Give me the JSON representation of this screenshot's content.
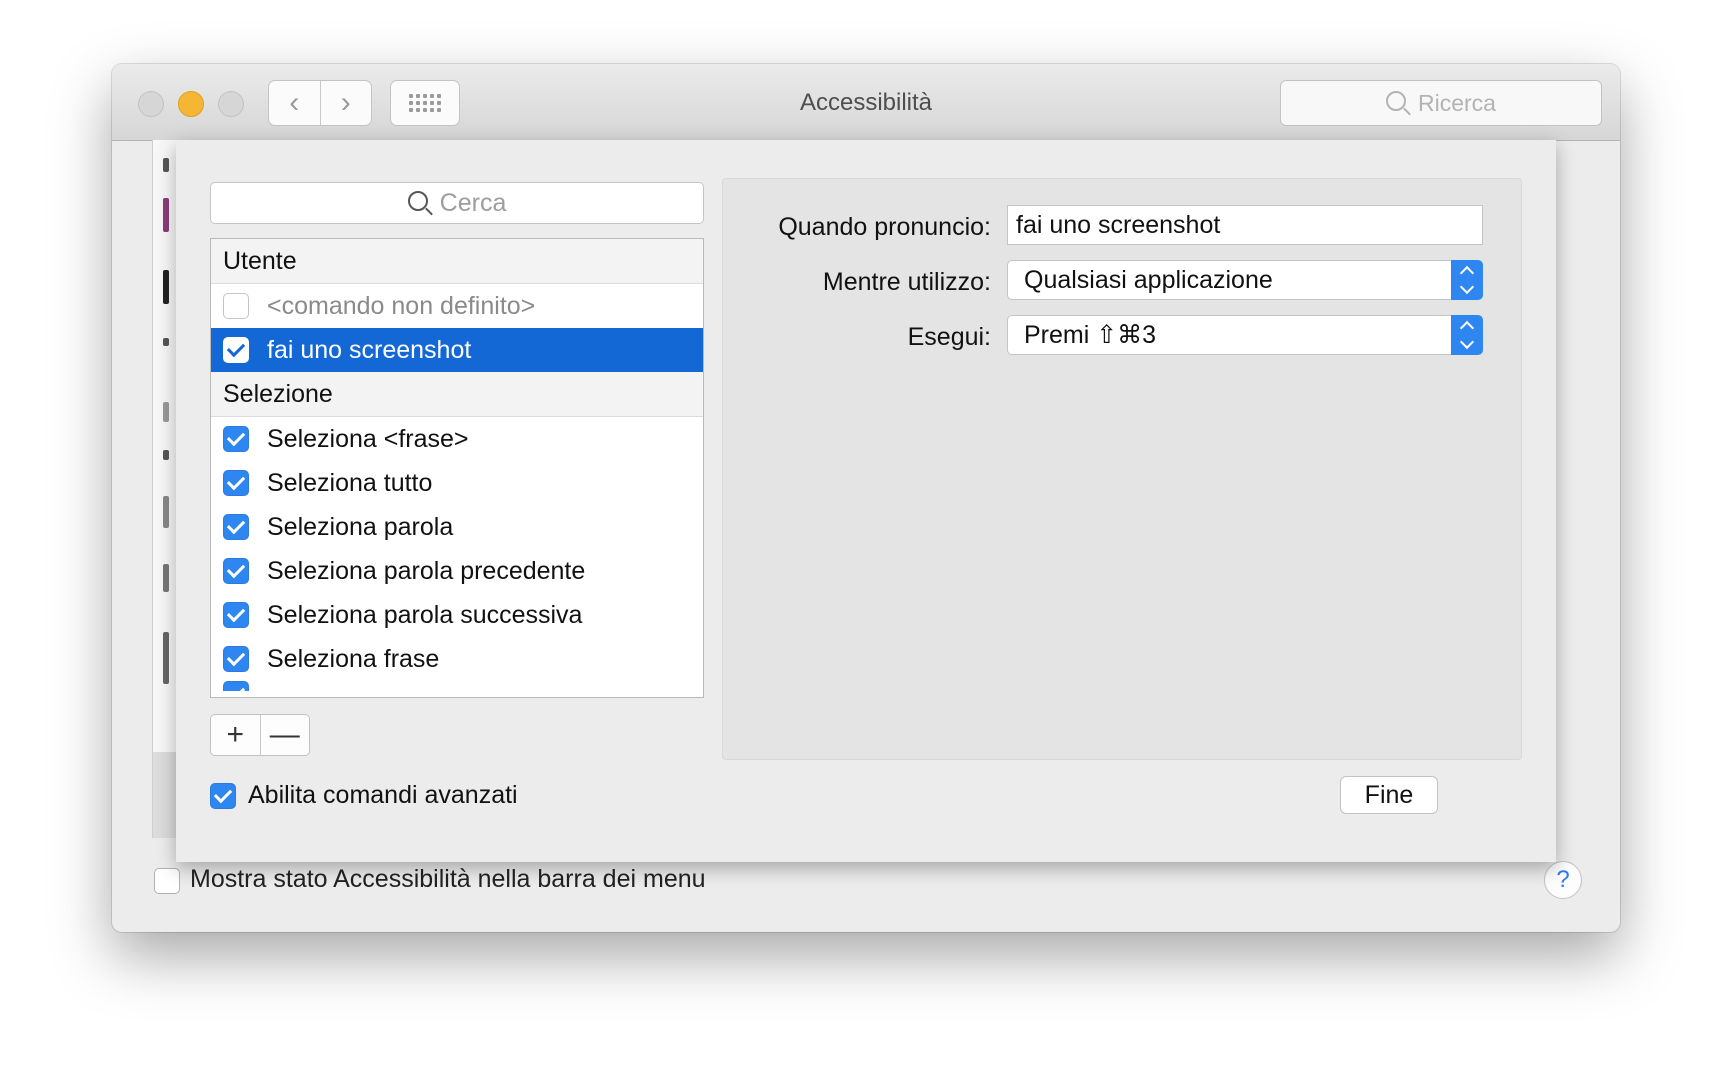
{
  "window": {
    "title": "Accessibilità",
    "search_placeholder": "Ricerca"
  },
  "icons": {
    "back": "chevron-left-icon",
    "forward": "chevron-right-icon",
    "show_all": "grid-icon",
    "search": "magnifier-icon",
    "add": "+",
    "remove": "—",
    "help": "?"
  },
  "footer": {
    "menu_status_label": "Mostra stato Accessibilità nella barra dei menu",
    "menu_status_checked": false
  },
  "sheet": {
    "search_placeholder": "Cerca",
    "groups": [
      {
        "name": "Utente",
        "items": [
          {
            "label": "<comando non definito>",
            "checked": false,
            "muted": true,
            "selected": false
          },
          {
            "label": "fai uno screenshot",
            "checked": true,
            "muted": false,
            "selected": true
          }
        ]
      },
      {
        "name": "Selezione",
        "items": [
          {
            "label": "Seleziona <frase>",
            "checked": true,
            "selected": false
          },
          {
            "label": "Seleziona tutto",
            "checked": true,
            "selected": false
          },
          {
            "label": "Seleziona parola",
            "checked": true,
            "selected": false
          },
          {
            "label": "Seleziona parola precedente",
            "checked": true,
            "selected": false
          },
          {
            "label": "Seleziona parola successiva",
            "checked": true,
            "selected": false
          },
          {
            "label": "Seleziona frase",
            "checked": true,
            "selected": false
          }
        ]
      }
    ],
    "detail": {
      "when_label": "Quando pronuncio:",
      "when_value": "fai uno screenshot",
      "while_label": "Mentre utilizzo:",
      "while_value": "Qualsiasi applicazione",
      "perform_label": "Esegui:",
      "perform_value": "Premi ⇧⌘3"
    },
    "advanced_label": "Abilita comandi avanzati",
    "advanced_checked": true,
    "done_label": "Fine"
  },
  "colors": {
    "accent": "#2e87f0",
    "selection": "#1368d6",
    "minimize": "#f5b635"
  }
}
